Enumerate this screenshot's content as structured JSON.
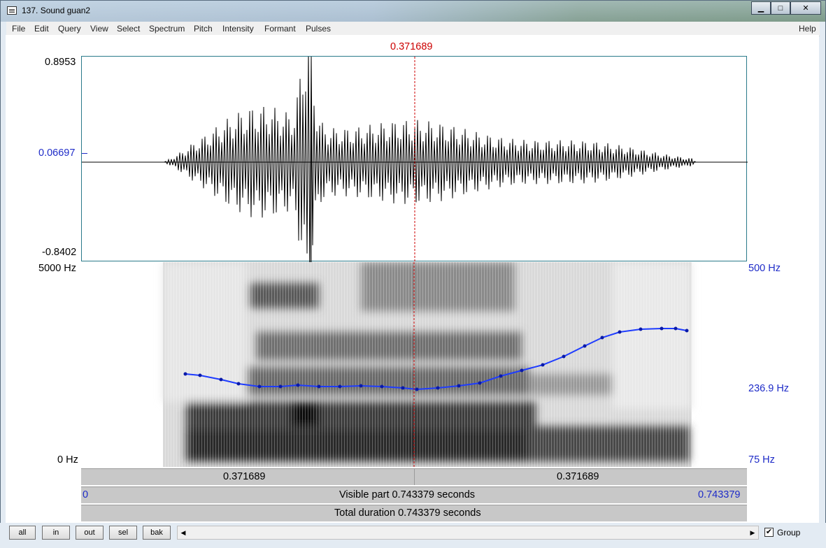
{
  "window": {
    "title": "137. Sound guan2",
    "minimize": "▁",
    "maximize": "□",
    "close": "✕"
  },
  "menu": [
    "File",
    "Edit",
    "Query",
    "View",
    "Select",
    "Spectrum",
    "Pitch",
    "Intensity",
    "Formant",
    "Pulses"
  ],
  "help": "Help",
  "cursor_time": "0.371689",
  "waveform": {
    "y_max": "0.8953",
    "y_mid": "0.06697",
    "y_min": "-0.8402"
  },
  "spectrogram": {
    "freq_top": "5000 Hz",
    "freq_bottom": "0 Hz",
    "pitch_top": "500 Hz",
    "pitch_mid": "236.9 Hz",
    "pitch_bottom": "75 Hz"
  },
  "timebar": {
    "left_segment": "0.371689",
    "right_segment": "0.371689",
    "visible_start": "0",
    "visible_label": "Visible part 0.743379 seconds",
    "visible_end": "0.743379",
    "total_label": "Total duration 0.743379 seconds"
  },
  "buttons": {
    "all": "all",
    "in": "in",
    "out": "out",
    "sel": "sel",
    "bak": "bak"
  },
  "scroll": {
    "left": "◀",
    "right": "▶"
  },
  "group": {
    "checked": "✔",
    "label": "Group"
  },
  "colors": {
    "pitch": "#1e3cff",
    "cursor": "#cc0000",
    "axis_blue": "#1e2bc8"
  }
}
